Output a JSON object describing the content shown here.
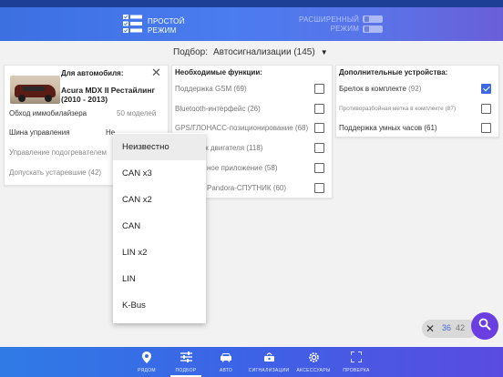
{
  "header": {
    "simple_mode_label": "ПРОСТОЙ\nРЕЖИМ",
    "advanced_mode_label": "РАСШИРЕННЫЙ\nРЕЖИМ"
  },
  "picker": {
    "label": "Подбор:",
    "value": "Автосигнализации (145)"
  },
  "vehicle_card": {
    "title": "Для автомобиля:",
    "model": "Acura MDX II Рестайлинг (2010 - 2013)",
    "immobilizer_label": "Обход иммобилайзера",
    "immobilizer_value": "50 моделей",
    "bus_label": "Шина управления",
    "bus_value_partial": "Не",
    "heater_label": "Управление подогревателем",
    "legacy_label": "Допускать устаревшие (42)"
  },
  "dropdown": {
    "options": [
      "Неизвестно",
      "CAN x3",
      "CAN x2",
      "CAN",
      "LIN x2",
      "LIN",
      "K-Bus"
    ],
    "selected_index": 0
  },
  "functions_card": {
    "title": "Необходимые функции:",
    "items": [
      {
        "label": "Поддержка GSM (69)",
        "checked": false
      },
      {
        "label": "Bluetooth-интерфейс (26)",
        "checked": false
      },
      {
        "label": "GPS/ГЛОНАСС-позиционирование (68)",
        "checked": false
      },
      {
        "label": "пуск двигателя (118)",
        "checked": false
      },
      {
        "label": "ное приложение (58)",
        "checked": false
      },
      {
        "label": "Pandora-СПУТНИК (60)",
        "checked": false
      }
    ]
  },
  "devices_card": {
    "title": "Дополнительные устройства:",
    "items": [
      {
        "label": "Брелок в комплекте",
        "count": "(92)",
        "checked": true
      },
      {
        "label": "Противоразбойная метка в комплекте (87)",
        "count": "",
        "checked": false
      },
      {
        "label": "Поддержка умных часов (61)",
        "count": "",
        "checked": false
      }
    ]
  },
  "result_pill": {
    "count_primary": "36",
    "count_secondary": "42"
  },
  "bottom_nav": {
    "items": [
      {
        "label": "РЯДОМ",
        "icon": "location-pin-icon"
      },
      {
        "label": "ПОДБОР",
        "icon": "sliders-icon"
      },
      {
        "label": "АВТО",
        "icon": "car-icon"
      },
      {
        "label": "СИГНАЛИЗАЦИИ",
        "icon": "alarm-icon"
      },
      {
        "label": "АКСЕССУАРЫ",
        "icon": "gear-icon"
      },
      {
        "label": "ПРОВЕРКА",
        "icon": "scan-frame-icon"
      }
    ],
    "active_index": 1
  },
  "colors": {
    "accent": "#3f69e0",
    "fab": "#6a3ee0"
  }
}
